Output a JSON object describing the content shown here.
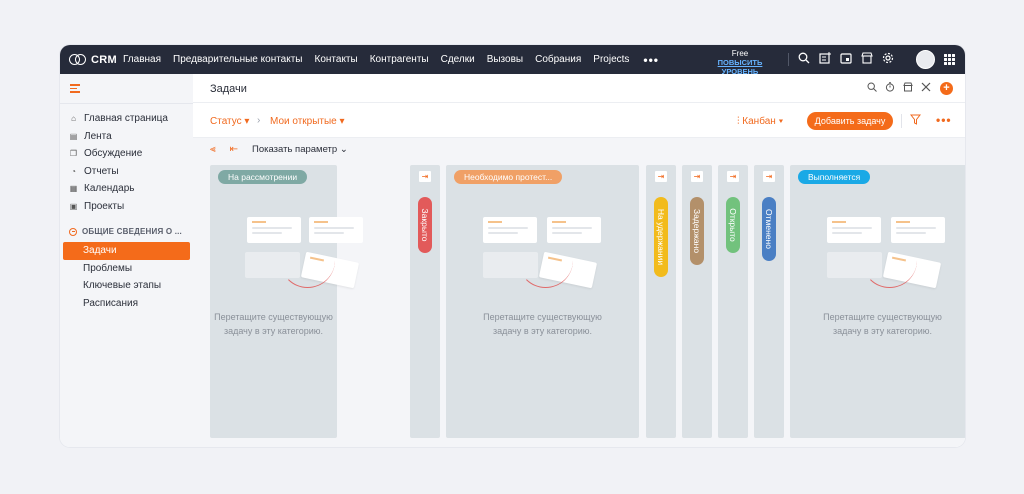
{
  "topnav": {
    "brand": "CRM",
    "links": [
      "Главная",
      "Предварительные контакты",
      "Контакты",
      "Контрагенты",
      "Сделки",
      "Вызовы",
      "Собрания",
      "Projects"
    ],
    "more": "•••",
    "plan": "Free",
    "upgrade_link": "ПОВЫСИТЬ УРОВЕНЬ"
  },
  "sidebar": {
    "items": [
      {
        "label": "Главная страница",
        "icon": "home-icon"
      },
      {
        "label": "Лента",
        "icon": "feed-icon"
      },
      {
        "label": "Обсуждение",
        "icon": "discussion-icon"
      },
      {
        "label": "Отчеты",
        "icon": "reports-icon"
      },
      {
        "label": "Календарь",
        "icon": "calendar-icon"
      },
      {
        "label": "Проекты",
        "icon": "projects-icon"
      }
    ],
    "section": "ОБЩИЕ СВЕДЕНИЯ О ...",
    "sub_items": [
      "Задачи",
      "Проблемы",
      "Ключевые этапы",
      "Расписания"
    ],
    "active": "Задачи"
  },
  "header": {
    "title": "Задачи"
  },
  "filterbar": {
    "status": "Статус",
    "view": "Мои открытые",
    "layout": "Канбан",
    "add_button": "Добавить задачу"
  },
  "board": {
    "show_param": "Показать параметр",
    "empty_text_1": "Перетащите существующую",
    "empty_text_2": "задачу в эту категорию.",
    "columns": [
      {
        "label": "На рассмотрении",
        "color": "#7fa9a4",
        "collapsed": false
      },
      {
        "label": "Закрыто",
        "color": "#e25a5a",
        "collapsed": true
      },
      {
        "label": "Необходимо протест...",
        "color": "#f0a066",
        "collapsed": false
      },
      {
        "label": "На удержании",
        "color": "#f2bb1c",
        "collapsed": true
      },
      {
        "label": "Задержано",
        "color": "#b3906a",
        "collapsed": true
      },
      {
        "label": "Открыто",
        "color": "#72c27d",
        "collapsed": true
      },
      {
        "label": "Отменено",
        "color": "#4a7fc4",
        "collapsed": true
      },
      {
        "label": "Выполняется",
        "color": "#1aa9e6",
        "collapsed": false
      }
    ]
  },
  "colors": {
    "accent": "#f46b1a",
    "nav_bg": "#262b3a"
  }
}
